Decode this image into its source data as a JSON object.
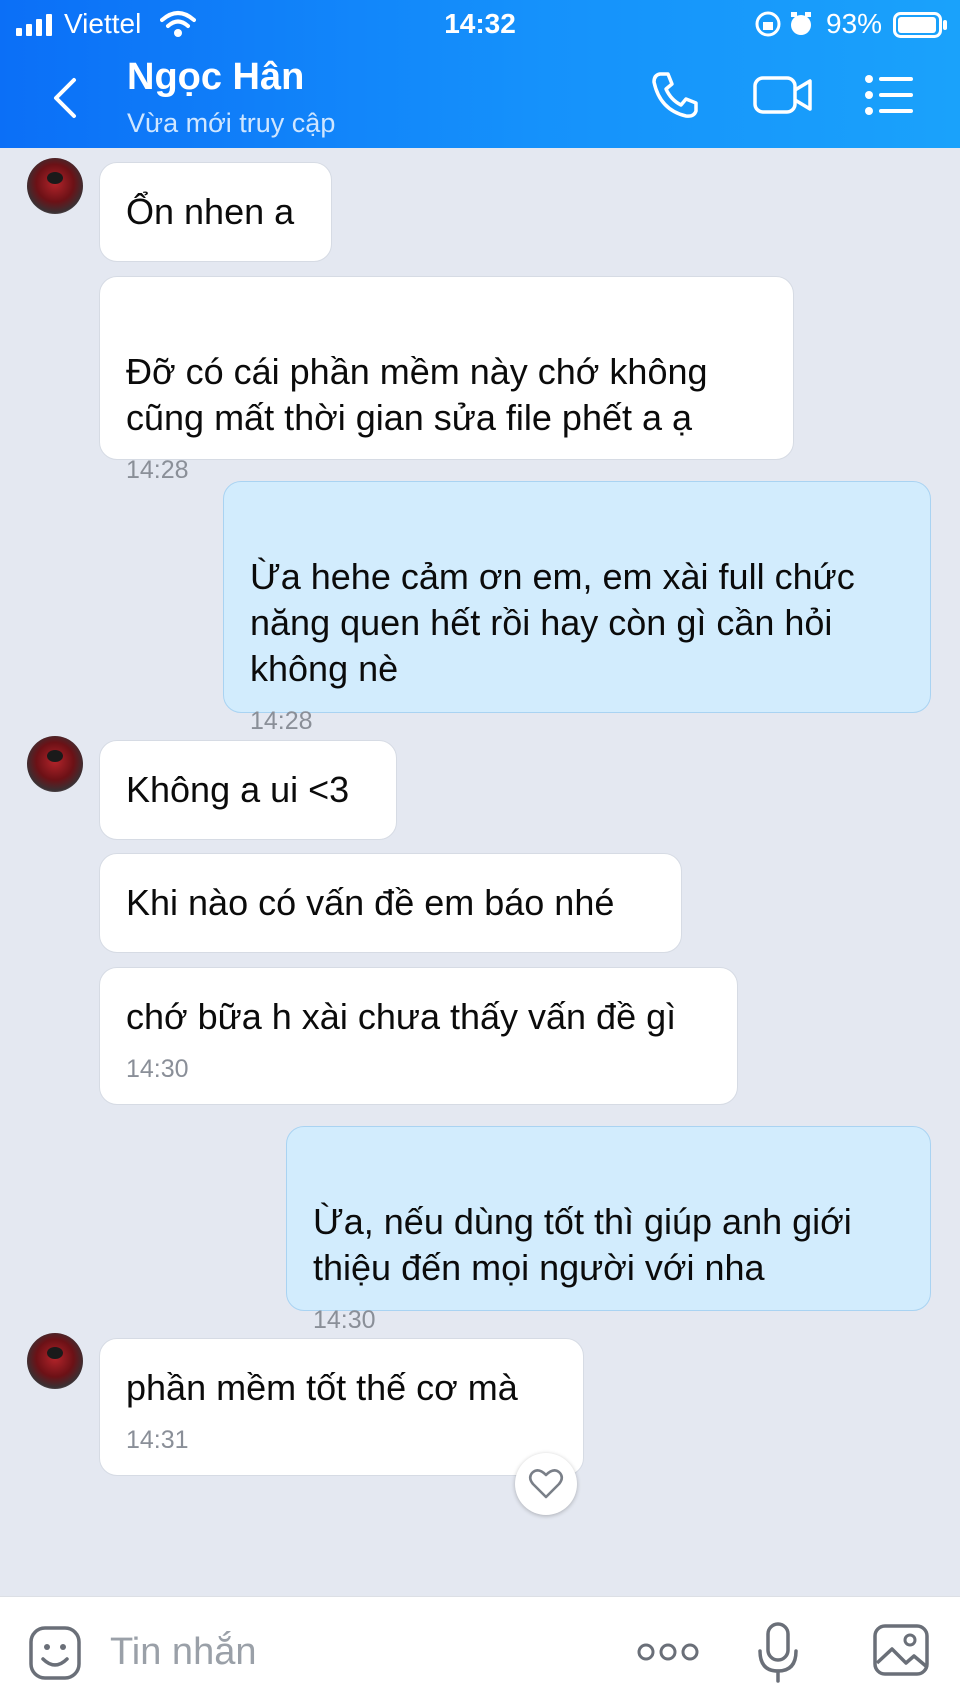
{
  "status_bar": {
    "carrier": "Viettel",
    "time": "14:32",
    "battery_percent": "93%"
  },
  "header": {
    "contact_name": "Ngọc Hân",
    "contact_status": "Vừa mới truy cập",
    "icons": [
      "back-icon",
      "phone-icon",
      "video-call-icon",
      "menu-list-icon"
    ]
  },
  "messages": [
    {
      "sender": "contact",
      "text": "Ổn nhen a",
      "time": ""
    },
    {
      "sender": "contact",
      "text": "Đỡ có cái phần mềm này chớ không\ncũng mất thời gian sửa file phết a ạ",
      "time": "14:28"
    },
    {
      "sender": "me",
      "text": "Ừa hehe cảm ơn em, em xài full chức\nnăng quen hết rồi hay còn gì cần hỏi\nkhông nè",
      "time": "14:28"
    },
    {
      "sender": "contact",
      "text": "Không a ui <3",
      "time": ""
    },
    {
      "sender": "contact",
      "text": "Khi nào có vấn đề em báo nhé",
      "time": ""
    },
    {
      "sender": "contact",
      "text": "chớ bữa h xài chưa thấy vấn đề gì",
      "time": "14:30"
    },
    {
      "sender": "me",
      "text": "Ừa, nếu dùng tốt thì giúp anh giới\nthiệu đến mọi người với nha",
      "time": "14:30"
    },
    {
      "sender": "contact",
      "text": "phần mềm tốt thế cơ mà",
      "time": "14:31"
    }
  ],
  "input": {
    "placeholder": "Tin nhắn",
    "icons": [
      "sticker-icon",
      "more-icon",
      "microphone-icon",
      "image-icon"
    ]
  },
  "colors": {
    "header_gradient_start": "#0b6ff7",
    "header_gradient_end": "#1aa2fb",
    "chat_background": "#e4e8f1",
    "incoming_bubble": "#ffffff",
    "outgoing_bubble": "#d2ecfd"
  }
}
